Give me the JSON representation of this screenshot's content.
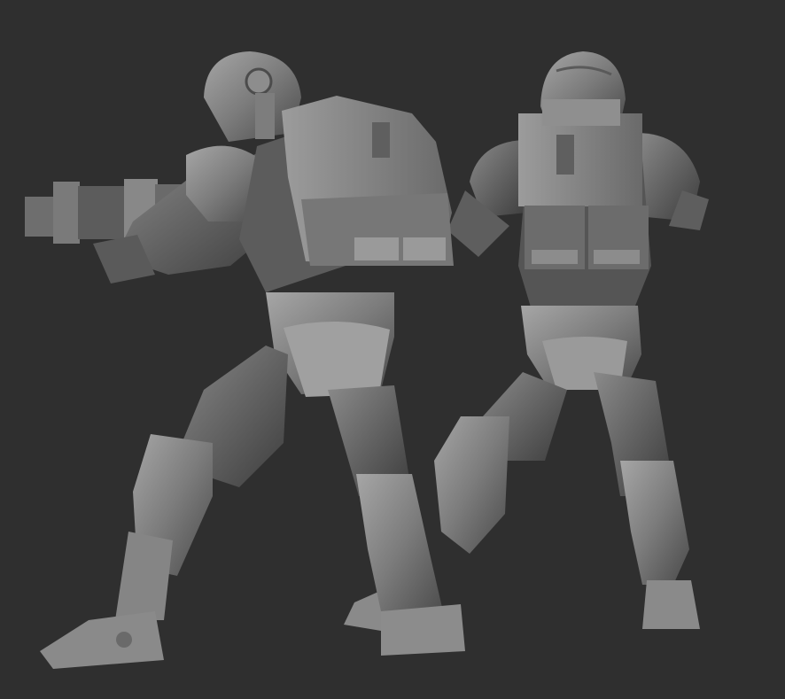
{
  "scene": {
    "description_hidden": "",
    "background_color": "#2f2f2f",
    "material_color": "#7a7a7a",
    "highlight_color": "#a3a3a3",
    "shadow_color": "#3c3c3c"
  }
}
